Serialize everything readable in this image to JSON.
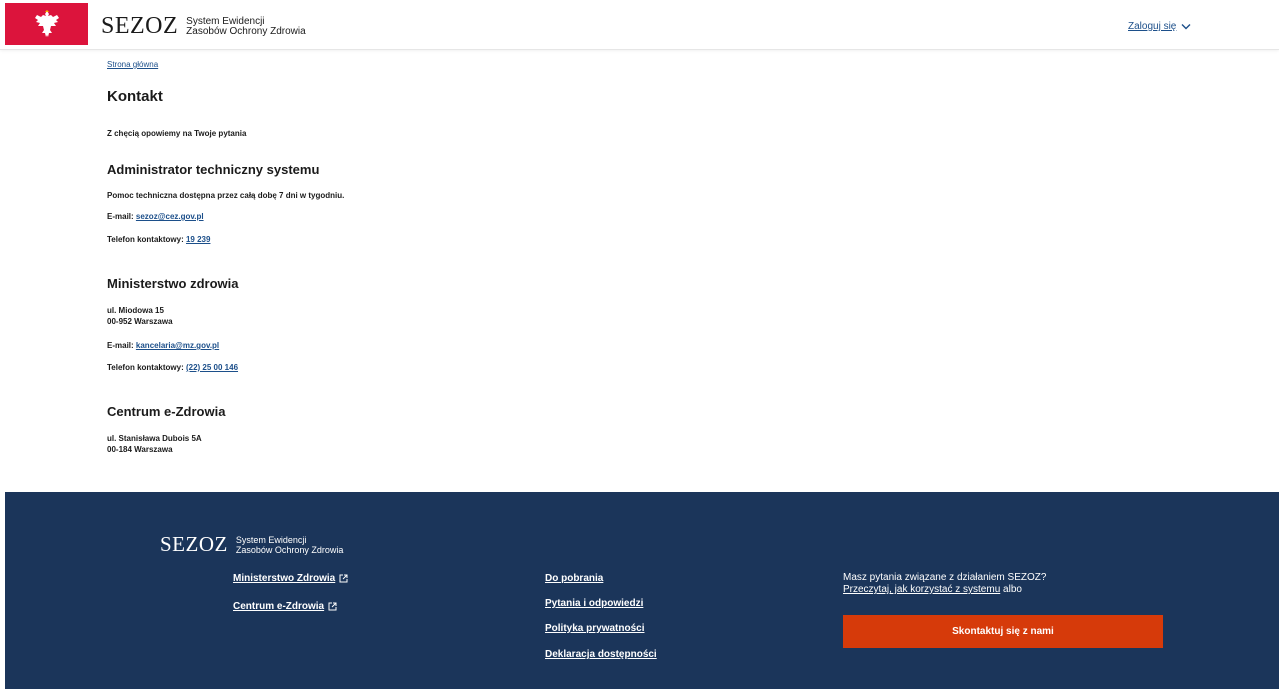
{
  "header": {
    "logo_main": "SEZOZ",
    "logo_sub_line1": "System Ewidencji",
    "logo_sub_line2": "Zasobów Ochrony Zdrowia",
    "login_label": "Zaloguj się",
    "flag_color": "#dc143c"
  },
  "breadcrumb": {
    "home": "Strona główna"
  },
  "page": {
    "title": "Kontakt",
    "intro": "Z chęcią opowiemy na Twoje pytania"
  },
  "sections": {
    "admin": {
      "heading": "Administrator techniczny systemu",
      "description": "Pomoc techniczna dostępna przez całą dobę 7 dni w tygodniu.",
      "email_label": "E-mail:",
      "email": "sezoz@cez.gov.pl",
      "phone_label": "Telefon kontaktowy:",
      "phone": "19 239"
    },
    "ministry": {
      "heading": "Ministerstwo zdrowia",
      "address1": "ul. Miodowa 15",
      "address2": "00-952 Warszawa",
      "email_label": "E-mail:",
      "email": "kancelaria@mz.gov.pl",
      "phone_label": "Telefon kontaktowy:",
      "phone": "(22) 25 00 146"
    },
    "cez": {
      "heading": "Centrum e-Zdrowia",
      "address1": "ul. Stanisława Dubois 5A",
      "address2": "00-184 Warszawa"
    }
  },
  "footer": {
    "logo_main": "SEZOZ",
    "logo_sub_line1": "System Ewidencji",
    "logo_sub_line2": "Zasobów Ochrony Zdrowia",
    "links_col1": [
      "Ministerstwo Zdrowia",
      "Centrum e-Zdrowia"
    ],
    "links_col2": [
      "Do pobrania",
      "Pytania i odpowiedzi",
      "Polityka prywatności",
      "Deklaracja dostępności"
    ],
    "question": "Masz pytania związane z działaniem SEZOZ?",
    "read_link": "Przeczytaj, jak korzystać z systemu",
    "or": "albo",
    "cta_label": "Skontaktuj się z nami",
    "bg_color": "#1b355a",
    "cta_color": "#d63a0a"
  }
}
